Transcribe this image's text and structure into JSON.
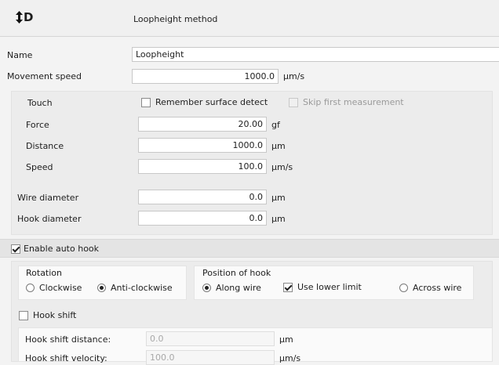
{
  "header": {
    "logo_text": "D",
    "title": "Loopheight method"
  },
  "name": {
    "label": "Name",
    "value": "Loopheight"
  },
  "movement_speed": {
    "label": "Movement speed",
    "value": "1000.0",
    "unit": "µm/s"
  },
  "touch": {
    "label": "Touch",
    "remember_label": "Remember surface detect",
    "remember_checked": false,
    "skip_label": "Skip first measurement",
    "skip_checked": false,
    "force": {
      "label": "Force",
      "value": "20.00",
      "unit": "gf"
    },
    "distance": {
      "label": "Distance",
      "value": "1000.0",
      "unit": "µm"
    },
    "speed": {
      "label": "Speed",
      "value": "100.0",
      "unit": "µm/s"
    }
  },
  "wire_diameter": {
    "label": "Wire diameter",
    "value": "0.0",
    "unit": "µm"
  },
  "hook_diameter": {
    "label": "Hook diameter",
    "value": "0.0",
    "unit": "µm"
  },
  "auto_hook": {
    "label": "Enable auto hook",
    "checked": true
  },
  "rotation": {
    "label": "Rotation",
    "options": [
      "Clockwise",
      "Anti-clockwise"
    ],
    "selected": "Anti-clockwise"
  },
  "position_of_hook": {
    "label": "Position of hook",
    "along_label": "Along wire",
    "along_selected": true,
    "lower_limit_label": "Use lower limit",
    "lower_limit_checked": true,
    "across_label": "Across wire",
    "across_selected": false
  },
  "hook_shift": {
    "label": "Hook shift",
    "checked": false,
    "distance": {
      "label": "Hook shift distance:",
      "value": "0.0",
      "unit": "µm"
    },
    "velocity": {
      "label": "Hook shift velocity:",
      "value": "100.0",
      "unit": "µm/s"
    }
  },
  "colors": {
    "background": "#f3f3f3",
    "panel": "#ececec",
    "input": "#ffffff",
    "disabled_text": "#a8a8a8"
  }
}
